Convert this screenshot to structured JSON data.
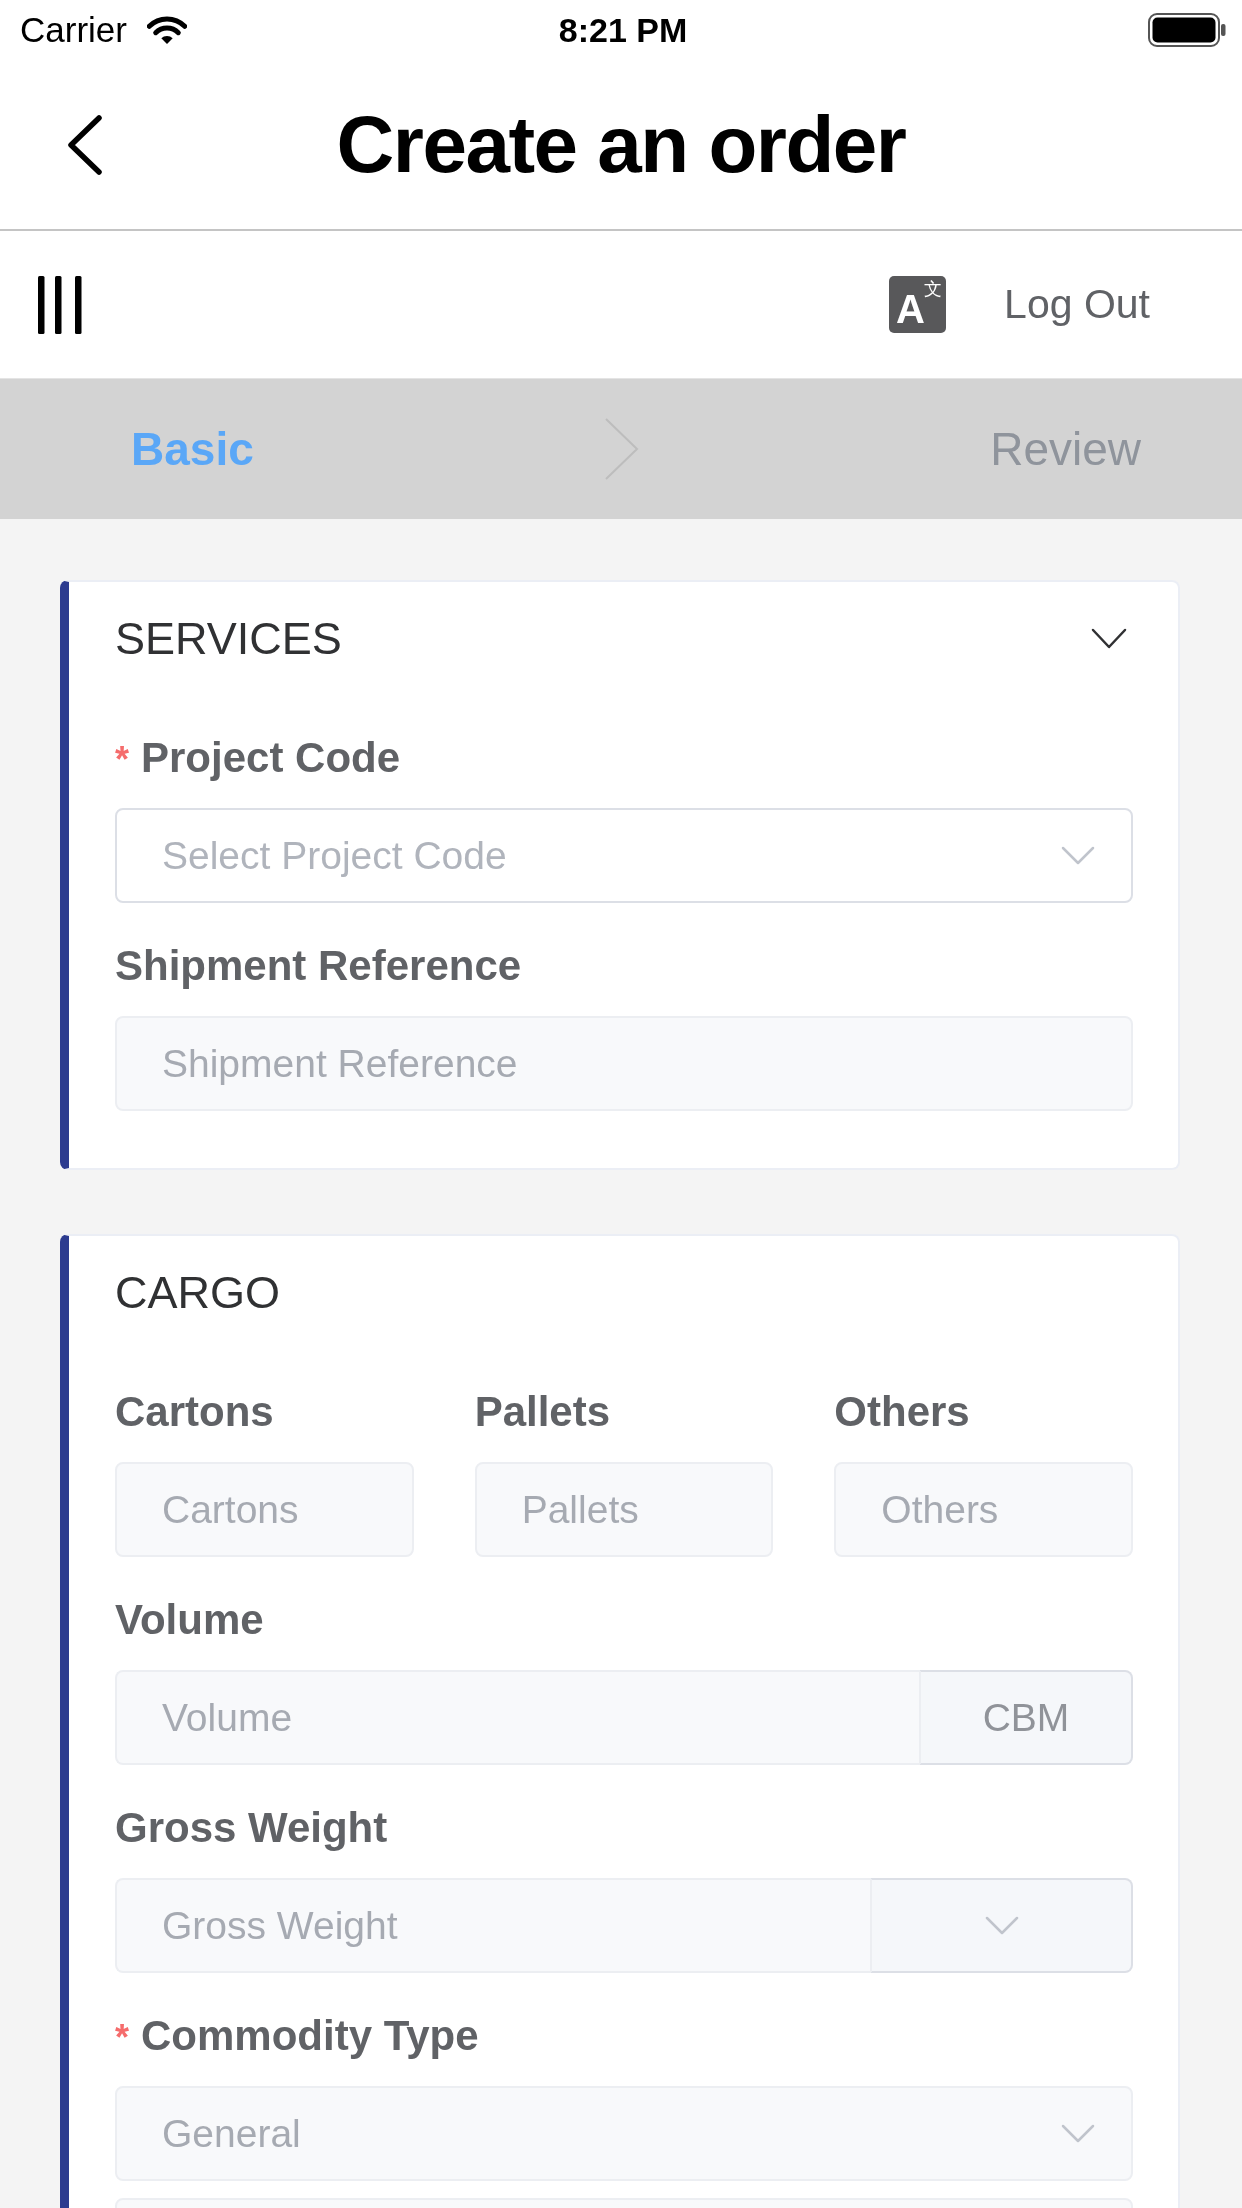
{
  "status_bar": {
    "carrier": "Carrier",
    "time": "8:21 PM"
  },
  "nav_bar": {
    "title": "Create an order"
  },
  "toolbar": {
    "language_button": {
      "letter": "A",
      "script": "文"
    },
    "logout": "Log Out"
  },
  "steps": [
    {
      "label": "Basic",
      "selected": true
    },
    {
      "label": "Review",
      "selected": false
    }
  ],
  "sections": [
    {
      "title": "SERVICES",
      "collapsible": true,
      "fields": [
        {
          "kind": "select",
          "label": "Project Code",
          "required_mark": "*",
          "placeholder": "Select Project Code",
          "disabled": false
        },
        {
          "kind": "input",
          "label": "Shipment Reference",
          "placeholder": "Shipment Reference",
          "disabled": true
        }
      ]
    },
    {
      "title": "CARGO",
      "collapsible": false,
      "fields": [
        {
          "kind": "row",
          "fields": [
            {
              "kind": "input",
              "label": "Cartons",
              "placeholder": "Cartons",
              "disabled": true
            },
            {
              "kind": "input",
              "label": "Pallets",
              "placeholder": "Pallets",
              "disabled": true
            },
            {
              "kind": "input",
              "label": "Others",
              "placeholder": "Others",
              "disabled": true
            }
          ]
        },
        {
          "kind": "input_unit",
          "label": "Volume",
          "placeholder": "Volume",
          "unit": "CBM",
          "disabled": true
        },
        {
          "kind": "input_select",
          "label": "Gross Weight",
          "placeholder": "Gross Weight",
          "disabled": true
        },
        {
          "kind": "select",
          "label": "Commodity Type",
          "required_mark": "*",
          "placeholder": "General",
          "disabled": true
        },
        {
          "kind": "input",
          "disabled": true
        }
      ]
    }
  ]
}
